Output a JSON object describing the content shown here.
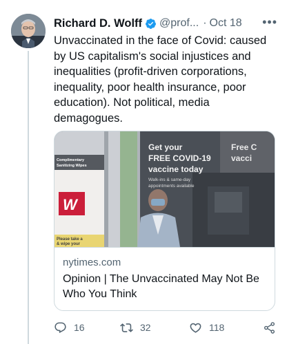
{
  "tweet": {
    "author_name": "Richard D. Wolff",
    "handle": "@prof...",
    "separator": "·",
    "date": "Oct 18",
    "more": "•••",
    "text": "Unvaccinated in the face of Covid: caused by US capitalism's social injustices and inequalities (profit-driven corporations, inequality, poor health insurance, poor education). Not political, media demagogues."
  },
  "card": {
    "domain": "nytimes.com",
    "title": "Opinion | The Unvaccinated May Not Be Who You Think",
    "image_text": {
      "line1": "Get your",
      "line2": "FREE COVID-19",
      "line3": "vaccine today",
      "small1": "Walk-ins & same-day",
      "small2": "appointments available",
      "right1": "Free C",
      "right2": "vacci",
      "left_sign1": "Complimentary",
      "left_sign2": "Sanitizing Wipes",
      "logo_letter": "W",
      "bottom_left1": "Please take a",
      "bottom_left2": "& wipe your"
    }
  },
  "actions": {
    "reply_count": "16",
    "retweet_count": "32",
    "like_count": "118"
  },
  "colors": {
    "text": "#0f1419",
    "secondary": "#536471",
    "border": "#cfd9de",
    "verified": "#1d9bf0",
    "logo_red": "#c8102e"
  },
  "icons": {
    "verified": "verified-badge-icon",
    "reply": "reply-icon",
    "retweet": "retweet-icon",
    "like": "heart-icon",
    "share": "share-icon",
    "more": "more-icon"
  }
}
